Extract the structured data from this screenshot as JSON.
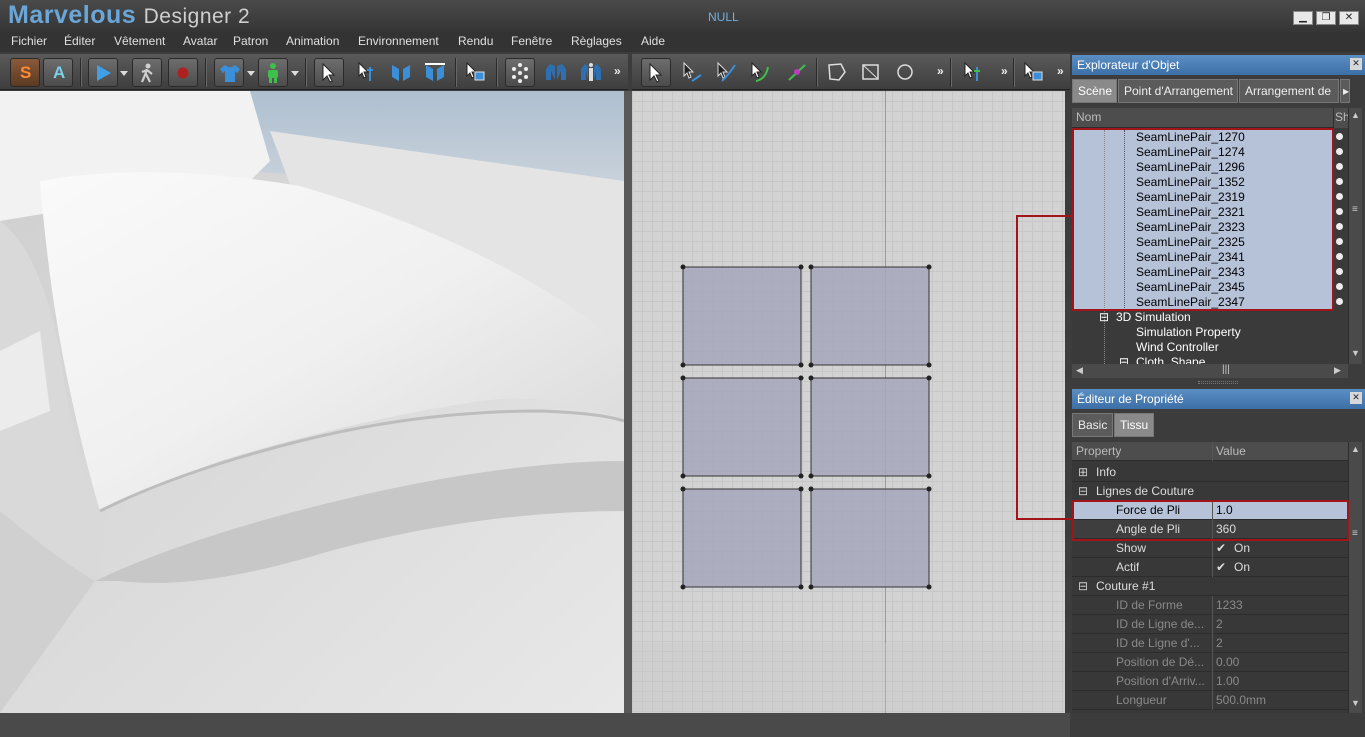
{
  "app": {
    "logo_main": "Marvelous",
    "logo_sub": "Designer 2",
    "window_title": "NULL",
    "min_glyph": "▁",
    "max_glyph": "❐",
    "close_glyph": "✕"
  },
  "menu": [
    "Fichier",
    "Éditer",
    "Vêtement",
    "Avatar",
    "Patron",
    "Animation",
    "Environnement",
    "Rendu",
    "Fenêtre",
    "Règlages",
    "Aide"
  ],
  "toolbar": {
    "s_label": "S",
    "a_label": "A",
    "more": "»"
  },
  "object_explorer": {
    "title": "Explorateur d'Objet",
    "tabs": [
      "Scène",
      "Point d'Arrangement",
      "Arrangement de"
    ],
    "col_name": "Nom",
    "col_show": "Sh",
    "selected_items": [
      "SeamLinePair_1270",
      "SeamLinePair_1274",
      "SeamLinePair_1296",
      "SeamLinePair_1352",
      "SeamLinePair_2319",
      "SeamLinePair_2321",
      "SeamLinePair_2323",
      "SeamLinePair_2325",
      "SeamLinePair_2341",
      "SeamLinePair_2343",
      "SeamLinePair_2345",
      "SeamLinePair_2347"
    ],
    "sim_group": "3D Simulation",
    "sim_children": [
      "Simulation Property",
      "Wind Controller"
    ],
    "clipped_item": "Cloth_Shape",
    "expand_glyph": "⊟"
  },
  "property_editor": {
    "title": "Éditeur de Propriété",
    "tabs": [
      "Basic",
      "Tissu"
    ],
    "col_property": "Property",
    "col_value": "Value",
    "info": "Info",
    "group1": "Lignes de Couture",
    "force_label": "Force de Pli",
    "force_value": "1.0",
    "angle_label": "Angle de Pli",
    "angle_value": "360",
    "show_label": "Show",
    "show_value": "On",
    "actif_label": "Actif",
    "actif_value": "On",
    "group2": "Couture #1",
    "readonly": [
      {
        "label": "ID de Forme",
        "value": "1233"
      },
      {
        "label": "ID de Ligne de...",
        "value": "2"
      },
      {
        "label": "ID de Ligne d'...",
        "value": "2"
      },
      {
        "label": "Position de Dé...",
        "value": "0.00"
      },
      {
        "label": "Position d'Arriv...",
        "value": "1.00"
      },
      {
        "label": "Longueur",
        "value": "500.0mm"
      }
    ]
  },
  "colors": {
    "accent": "#5b8fc4",
    "selection": "#b6c2d8",
    "highlight_box": "#a0141a",
    "pattern_fill": "#a6a6bc"
  }
}
